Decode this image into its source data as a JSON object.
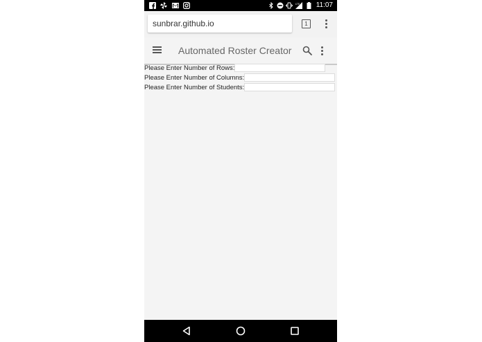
{
  "status_bar": {
    "time": "11:07",
    "icons_left": [
      "facebook-icon",
      "pinwheel-icon",
      "gmail-icon",
      "instagram-icon"
    ],
    "icons_right": [
      "bluetooth-icon",
      "do-not-disturb-icon",
      "vibrate-icon",
      "lte-signal-icon",
      "battery-icon"
    ]
  },
  "browser": {
    "url": "sunbrar.github.io",
    "tab_count": "1"
  },
  "app_bar": {
    "title": "Automated Roster Creator"
  },
  "form": {
    "rows_label": "Please Enter Number of Rows:",
    "rows_value": "",
    "columns_label": "Please Enter Number of Columns:",
    "columns_value": "",
    "students_label": "Please Enter Number of Students:",
    "students_value": ""
  },
  "colors": {
    "status_bar_bg": "#000000",
    "chrome_bg": "#f2f2f2",
    "page_bg": "#f4f4f4",
    "nav_bar_bg": "#000000"
  }
}
